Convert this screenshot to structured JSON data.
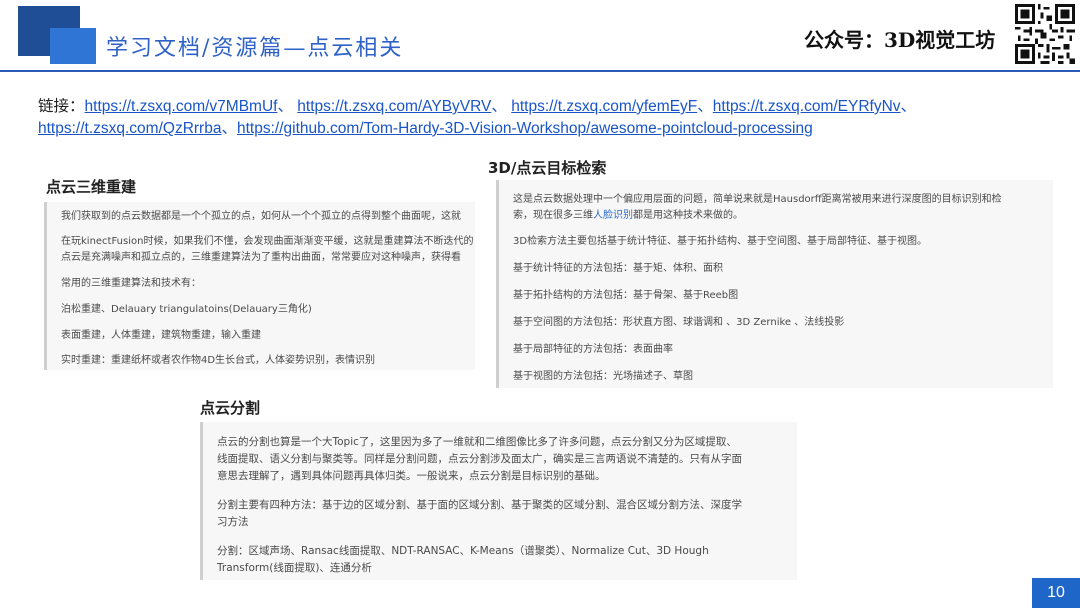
{
  "header": {
    "title": "学习文档/资源篇—点云相关",
    "right_label": "公众号：3D视觉工坊"
  },
  "links": {
    "prefix": "链接：",
    "items": [
      "https://t.zsxq.com/v7MBmUf",
      "https://t.zsxq.com/AYByVRV",
      "https://t.zsxq.com/yfemEyF",
      "https://t.zsxq.com/EYRfyNv",
      "https://t.zsxq.com/QzRrrba",
      "https://github.com/Tom-Hardy-3D-Vision-Workshop/awesome-pointcloud-processing"
    ],
    "separator": "、"
  },
  "sections": {
    "recon": {
      "title": "点云三维重建",
      "lines": [
        "我们获取到的点云数据都是一个个孤立的点，如何从一个个孤立的点得到整个曲面呢，这就",
        "在玩kinectFusion时候，如果我们不懂，会发现曲面渐渐变平缓，这就是重建算法不断迭代的",
        "点云是充满噪声和孤立点的，三维重建算法为了重构出曲面，常常要应对这种噪声，获得看",
        "常用的三维重建算法和技术有：",
        "泊松重建、Delauary triangulatoins(Delauary三角化)",
        "表面重建，人体重建，建筑物重建，输入重建",
        "实时重建：重建纸杯或者农作物4D生长台式，人体姿势识别，表情识别"
      ]
    },
    "detect": {
      "title": "3D/点云目标检索",
      "line1a": "这是点云数据处理中一个偏应用层面的问题，简单说来就是Hausdorff距离常被用来进行深度图的目标识别和检",
      "line1b_pre": "索，现在很多三维",
      "line1b_link": "人脸识别",
      "line1b_post": "都是用这种技术来做的。",
      "lines": [
        "3D检索方法主要包括基于统计特征、基于拓扑结构、基于空间图、基于局部特征、基于视图。",
        "基于统计特征的方法包括：基于矩、体积、面积",
        "基于拓扑结构的方法包括：基于骨架、基于Reeb图",
        "基于空间图的方法包括：形状直方图、球谐调和 、3D Zernike 、法线投影",
        "基于局部特征的方法包括：表面曲率",
        "基于视图的方法包括：光场描述子、草图"
      ]
    },
    "seg": {
      "title": "点云分割",
      "lines": [
        "点云的分割也算是一个大Topic了，这里因为多了一维就和二维图像比多了许多问题，点云分割又分为区域提取、",
        "线面提取、语义分割与聚类等。同样是分割问题，点云分割涉及面太广，确实是三言两语说不清楚的。只有从字面",
        "意思去理解了，遇到具体问题再具体归类。一般说来，点云分割是目标识别的基础。",
        "分割主要有四种方法：基于边的区域分割、基于面的区域分割、基于聚类的区域分割、混合区域分割方法、深度学",
        "习方法",
        "分割：区域声场、Ransac线面提取、NDT-RANSAC、K-Means（谱聚类）、Normalize Cut、3D Hough",
        "Transform(线面提取)、连通分析"
      ]
    }
  },
  "page_number": "10",
  "colors": {
    "brand_dark": "#1f4e96",
    "brand_light": "#2f75d6",
    "title_blue": "#2e62c8",
    "link_blue": "#1a55c8"
  }
}
